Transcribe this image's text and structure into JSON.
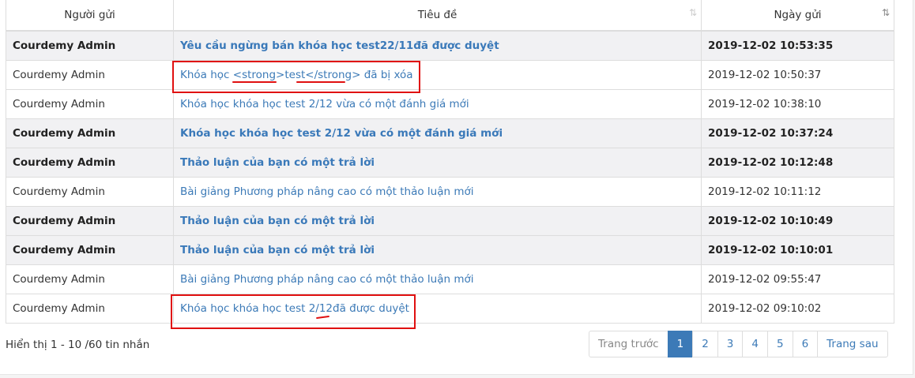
{
  "columns": {
    "sender": "Người gửi",
    "subject": "Tiêu đề",
    "date": "Ngày gửi"
  },
  "sort_icon": "⇅",
  "rows": [
    {
      "sender": "Courdemy Admin",
      "subject": "Yêu cầu ngừng bán khóa học test22/11đã được duyệt",
      "date": "2019-12-02 10:53:35",
      "unread": true
    },
    {
      "sender": "Courdemy Admin",
      "subject": "Khóa học <strong>test</strong> đã bị xóa",
      "date": "2019-12-02 10:50:37",
      "unread": false
    },
    {
      "sender": "Courdemy Admin",
      "subject": "Khóa học khóa học test 2/12 vừa có một đánh giá mới",
      "date": "2019-12-02 10:38:10",
      "unread": false
    },
    {
      "sender": "Courdemy Admin",
      "subject": "Khóa học khóa học test 2/12 vừa có một đánh giá mới",
      "date": "2019-12-02 10:37:24",
      "unread": true
    },
    {
      "sender": "Courdemy Admin",
      "subject": "Thảo luận của bạn có một trả lời",
      "date": "2019-12-02 10:12:48",
      "unread": true
    },
    {
      "sender": "Courdemy Admin",
      "subject": "Bài giảng Phương pháp nâng cao có một thảo luận mới",
      "date": "2019-12-02 10:11:12",
      "unread": false
    },
    {
      "sender": "Courdemy Admin",
      "subject": "Thảo luận của bạn có một trả lời",
      "date": "2019-12-02 10:10:49",
      "unread": true
    },
    {
      "sender": "Courdemy Admin",
      "subject": "Thảo luận của bạn có một trả lời",
      "date": "2019-12-02 10:10:01",
      "unread": true
    },
    {
      "sender": "Courdemy Admin",
      "subject": "Bài giảng Phương pháp nâng cao có một thảo luận mới",
      "date": "2019-12-02 09:55:47",
      "unread": false
    },
    {
      "sender": "Courdemy Admin",
      "subject": "Khóa học khóa học test 2/12đã được duyệt",
      "date": "2019-12-02 09:10:02",
      "unread": false
    }
  ],
  "footer": {
    "info": "Hiển thị 1 - 10 /60 tin nhắn"
  },
  "pagination": {
    "prev": "Trang trước",
    "pages": [
      "1",
      "2",
      "3",
      "4",
      "5",
      "6"
    ],
    "current": "1",
    "next": "Trang sau"
  },
  "colors": {
    "link": "#3c7ab7",
    "annotation": "#e01010",
    "unread_bg": "#f1f1f3"
  }
}
